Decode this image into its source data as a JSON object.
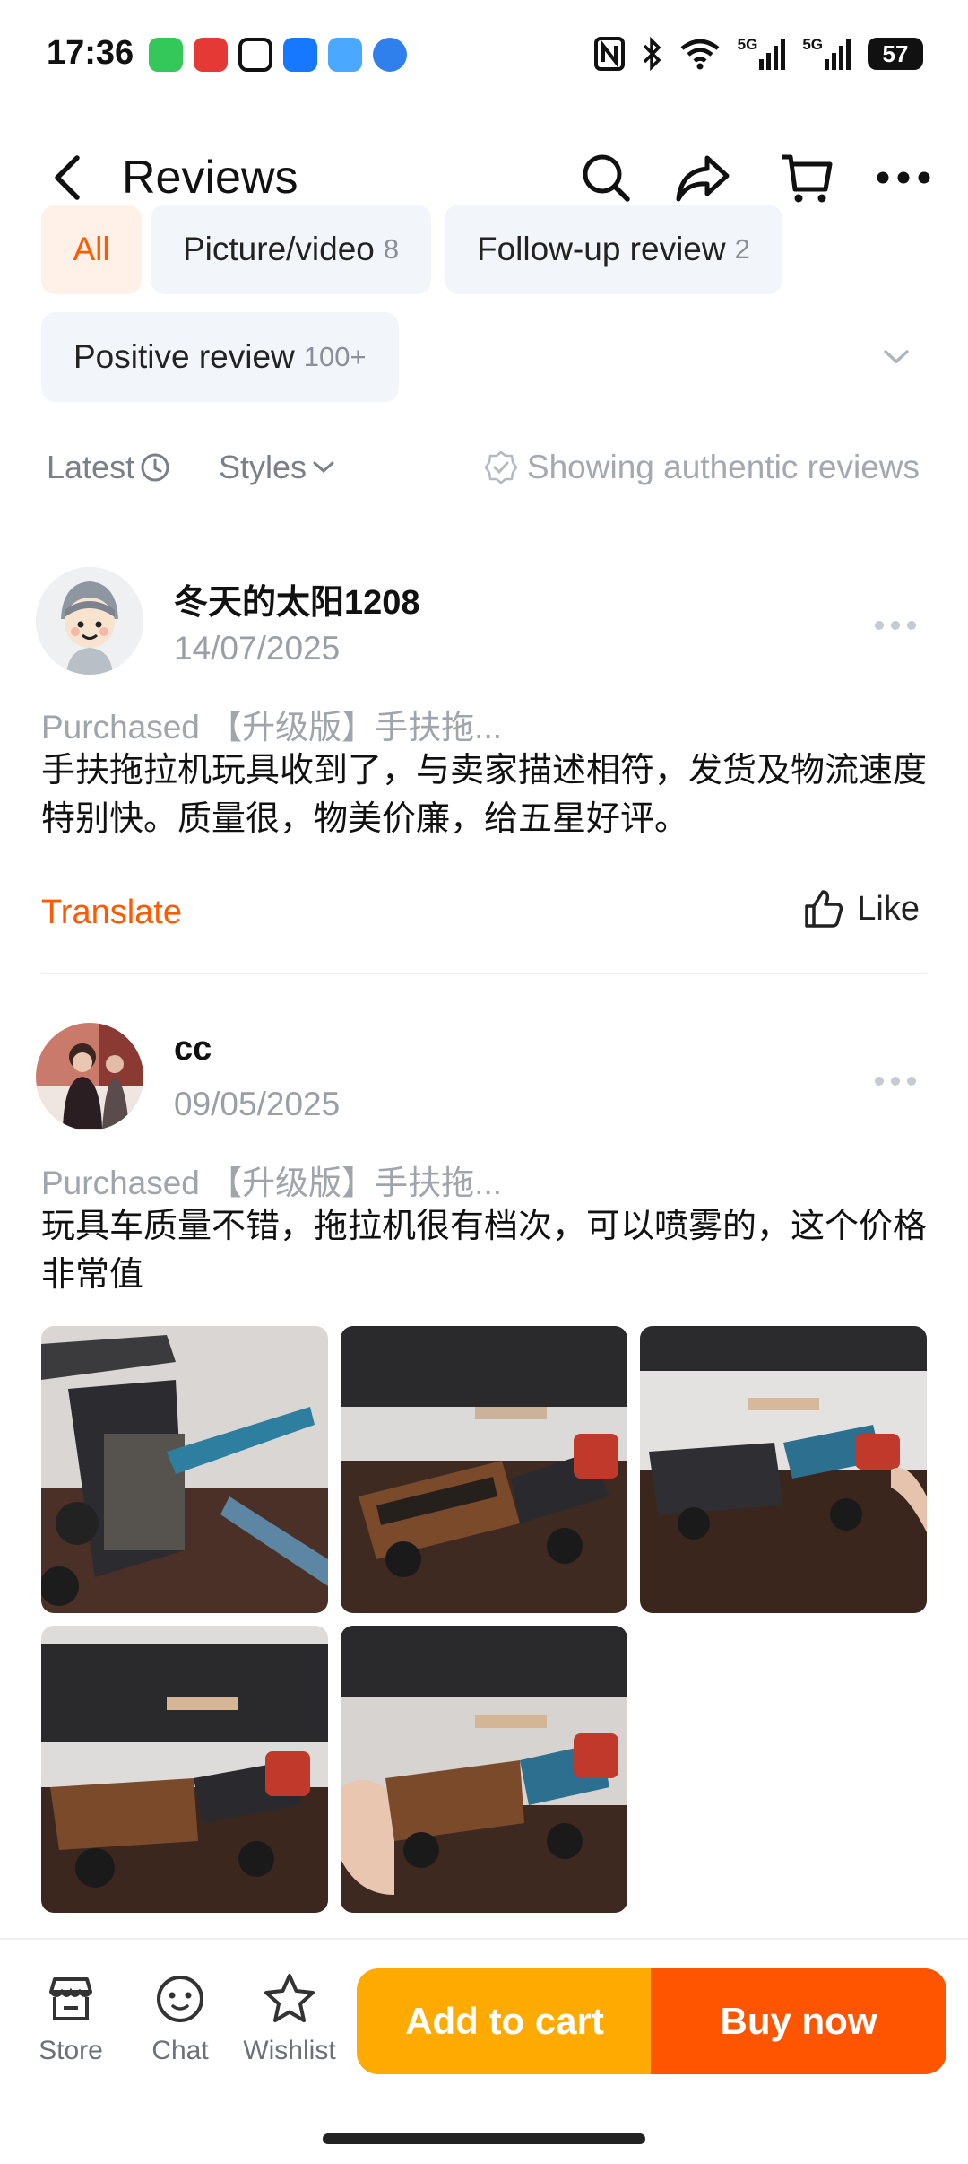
{
  "status_bar": {
    "time": "17:36",
    "battery": "57",
    "signal1": "5G",
    "signal2": "5G"
  },
  "header": {
    "title": "Reviews",
    "icons": [
      "back-icon",
      "search-icon",
      "share-icon",
      "cart-icon",
      "more-icon"
    ]
  },
  "filters": {
    "chips": [
      {
        "label": "All",
        "count": ""
      },
      {
        "label": "Picture/video",
        "count": "8"
      },
      {
        "label": "Follow-up review",
        "count": "2"
      },
      {
        "label": "Positive review",
        "count": "100+"
      }
    ]
  },
  "sort": {
    "latest": "Latest",
    "styles": "Styles",
    "authentic": "Showing authentic reviews"
  },
  "reviews": [
    {
      "name": "冬天的太阳1208",
      "date": "14/07/2025",
      "purchased": "Purchased 【升级版】手扶拖...",
      "text": "手扶拖拉机玩具收到了，与卖家描述相符，发货及物流速度特别快。质量很，物美价廉，给五星好评。",
      "translate": "Translate",
      "like": "Like"
    },
    {
      "name": "cc",
      "date": "09/05/2025",
      "purchased": "Purchased 【升级版】手扶拖...",
      "text": "玩具车质量不错，拖拉机很有档次，可以喷雾的，这个价格非常值",
      "photos": 5
    }
  ],
  "bottom_bar": {
    "store": "Store",
    "chat": "Chat",
    "wishlist": "Wishlist",
    "add_to_cart": "Add to cart",
    "buy_now": "Buy now"
  },
  "colors": {
    "accent": "#ff5a00",
    "cart_button": "#ffaa00",
    "buy_button": "#ff5500"
  }
}
